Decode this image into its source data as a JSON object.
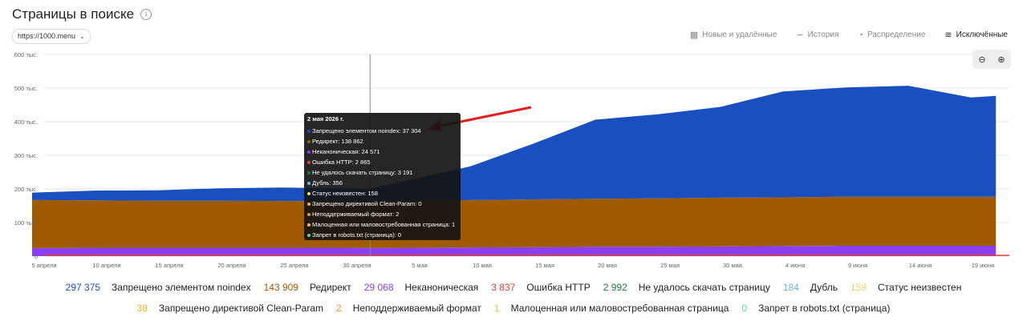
{
  "header": {
    "title": "Страницы в поиске",
    "info_icon": "info-icon"
  },
  "site_selector": {
    "value": "https://1000.menu",
    "icon": "chevron-down-icon"
  },
  "tabs": [
    {
      "label": "Новые и удалённые",
      "icon": "table-icon",
      "active": false
    },
    {
      "label": "История",
      "icon": "history-chart-icon",
      "active": false
    },
    {
      "label": "Распределение",
      "icon": "pie-icon",
      "active": false
    },
    {
      "label": "Исключённые",
      "icon": "excluded-chart-icon",
      "active": true
    }
  ],
  "zoom": {
    "zoom_out_icon": "zoom-out-icon",
    "zoom_in_icon": "zoom-in-icon"
  },
  "tooltip": {
    "date": "2 мая 2026 г.",
    "rows": [
      {
        "label": "Запрещено элементом noindex: 37 304",
        "color": "#1a4fbf"
      },
      {
        "label": "Редирект: 138 862",
        "color": "#a05a00"
      },
      {
        "label": "Неканоническая: 24 571",
        "color": "#8a3ff2"
      },
      {
        "label": "Ошибка HTTP: 2 865",
        "color": "#e0443a"
      },
      {
        "label": "Не удалось скачать страницу: 3 191",
        "color": "#1f7a3e"
      },
      {
        "label": "Дубль: 356",
        "color": "#6fb5ee"
      },
      {
        "label": "Статус неизвестен: 158",
        "color": "#f3d36b"
      },
      {
        "label": "Запрещено директивой Clean-Param: 0",
        "color": "#f5b325"
      },
      {
        "label": "Неподдерживаемый формат: 2",
        "color": "#f09530"
      },
      {
        "label": "Малоценная или маловостребованная страница: 1",
        "color": "#f2c14a"
      },
      {
        "label": "Запрет в robots.txt (страница): 0",
        "color": "#5fd0b0"
      }
    ]
  },
  "legend": {
    "row1": [
      {
        "value": "297 375",
        "label": "Запрещено элементом noindex",
        "color": "#1a4fbf"
      },
      {
        "value": "143 909",
        "label": "Редирект",
        "color": "#a05a00"
      },
      {
        "value": "29 068",
        "label": "Неканоническая",
        "color": "#8a3ff2"
      },
      {
        "value": "3 837",
        "label": "Ошибка HTTP",
        "color": "#e0443a"
      },
      {
        "value": "2 992",
        "label": "Не удалось скачать страницу",
        "color": "#1f7a3e"
      },
      {
        "value": "184",
        "label": "Дубль",
        "color": "#6fb5ee"
      },
      {
        "value": "159",
        "label": "Статус неизвестен",
        "color": "#f3d36b"
      }
    ],
    "row2": [
      {
        "value": "38",
        "label": "Запрещено директивой Clean-Param",
        "color": "#f5b325"
      },
      {
        "value": "2",
        "label": "Неподдерживаемый формат",
        "color": "#f09530"
      },
      {
        "value": "1",
        "label": "Малоценная или маловостребованная страница",
        "color": "#f2c14a"
      },
      {
        "value": "0",
        "label": "Запрет в robots.txt (страница)",
        "color": "#5fd0b0"
      }
    ]
  },
  "chart_data": {
    "type": "area",
    "stacked": true,
    "x": [
      "2026-04-05",
      "2026-04-10",
      "2026-04-15",
      "2026-04-20",
      "2026-04-25",
      "2026-04-30",
      "2026-05-02",
      "2026-05-05",
      "2026-05-10",
      "2026-05-15",
      "2026-05-20",
      "2026-05-25",
      "2026-05-30",
      "2026-06-04",
      "2026-06-09",
      "2026-06-14",
      "2026-06-19",
      "2026-06-21"
    ],
    "x_ticks": [
      "5 апреля",
      "10 апреля",
      "15 апреля",
      "20 апреля",
      "25 апреля",
      "30 апреля",
      "5 мая",
      "10 мая",
      "15 мая",
      "20 мая",
      "25 мая",
      "30 мая",
      "4 июня",
      "9 июня",
      "14 июня",
      "19 июня"
    ],
    "y_ticks": [
      "0",
      "100 тыс.",
      "200 тыс.",
      "300 тыс.",
      "400 тыс.",
      "500 тыс.",
      "600 тыс."
    ],
    "ylim": [
      0,
      600000
    ],
    "grid": true,
    "series": [
      {
        "name": "Неканоническая",
        "color": "#8a3ff2",
        "values": [
          24000,
          25000,
          25000,
          25000,
          25000,
          25000,
          24571,
          25000,
          26000,
          27000,
          28000,
          28000,
          29000,
          30000,
          31000,
          31000,
          31000,
          31000
        ]
      },
      {
        "name": "Редирект",
        "color": "#a05a00",
        "values": [
          143000,
          141000,
          140000,
          140000,
          139000,
          139000,
          138862,
          140000,
          141000,
          142000,
          143000,
          144000,
          145000,
          145000,
          146000,
          146000,
          146000,
          146000
        ]
      },
      {
        "name": "Запрещено элементом noindex",
        "color": "#1a4fbf",
        "values": [
          22000,
          29000,
          31000,
          37000,
          40000,
          37000,
          37304,
          60000,
          100000,
          165000,
          235000,
          250000,
          270000,
          315000,
          325000,
          330000,
          295000,
          300000
        ]
      }
    ],
    "crosshair_x": "2026-05-02"
  }
}
